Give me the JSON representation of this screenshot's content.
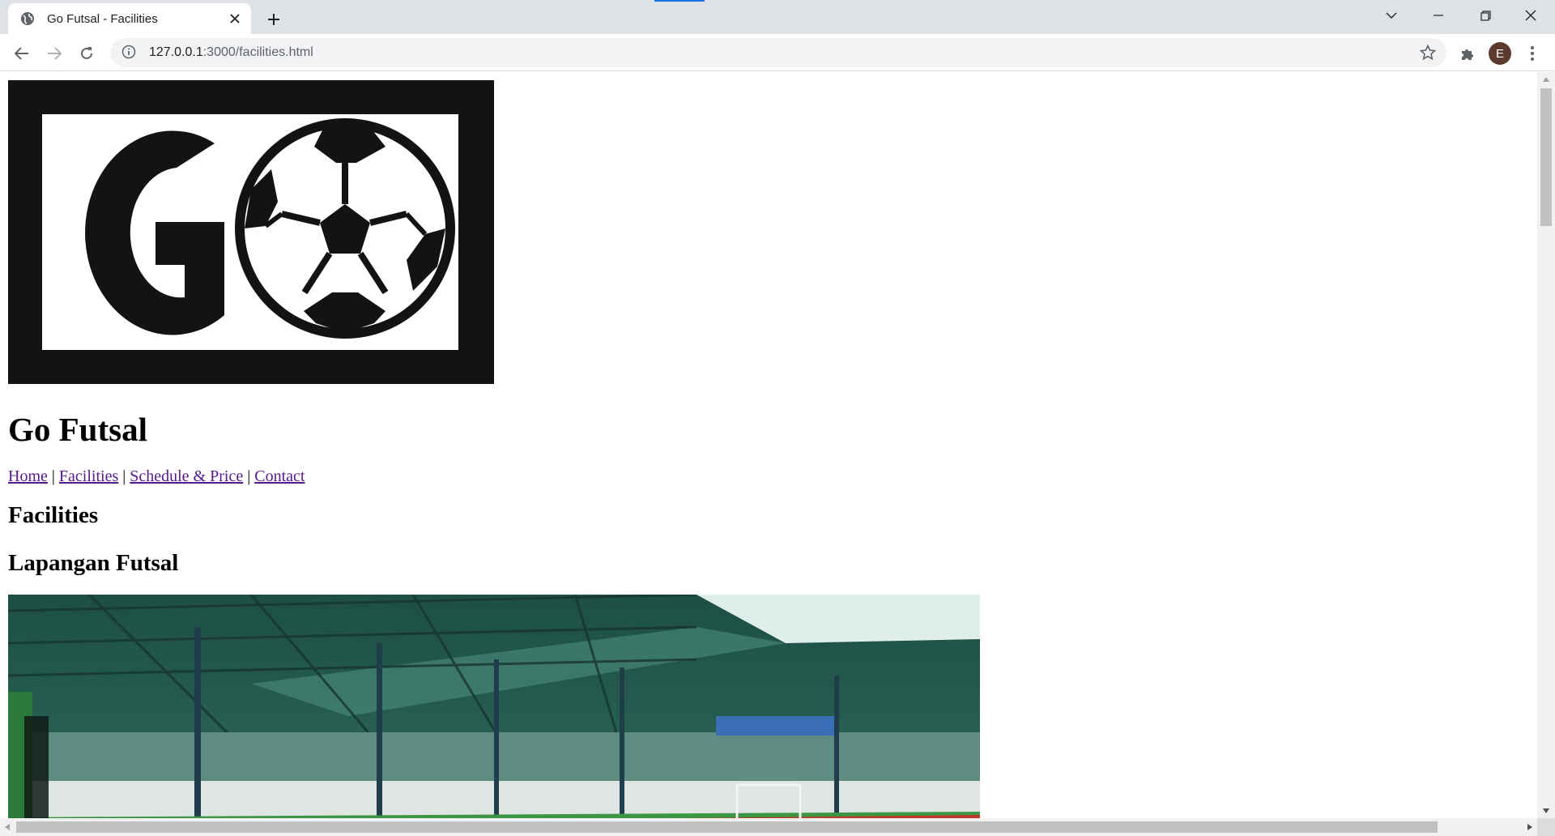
{
  "browser": {
    "tab_title": "Go Futsal - Facilities",
    "url_host": "127.0.0.1",
    "url_path": ":3000/facilities.html",
    "profile_initial": "E",
    "icons": {
      "favicon": "globe-icon",
      "tab_close": "close-icon",
      "new_tab": "plus-icon",
      "back": "arrow-left-icon",
      "forward": "arrow-right-icon",
      "reload": "reload-icon",
      "site_info": "info-icon",
      "bookmark": "star-icon",
      "extensions": "puzzle-icon",
      "menu": "kebab-menu-icon",
      "tab_search": "chevron-down-icon",
      "minimize": "minimize-icon",
      "restore": "restore-icon",
      "close_window": "close-icon"
    }
  },
  "page": {
    "logo_text": "GO",
    "title": "Go Futsal",
    "nav": [
      {
        "label": "Home"
      },
      {
        "label": "Facilities"
      },
      {
        "label": "Schedule & Price"
      },
      {
        "label": "Contact"
      }
    ],
    "nav_separator": "|",
    "heading": "Facilities",
    "section_heading": "Lapangan Futsal"
  },
  "colors": {
    "visited_link": "#551a8b",
    "logo_black": "#141213",
    "turf_green": "#2f8a3a",
    "roof_green": "#1f5d4a"
  }
}
